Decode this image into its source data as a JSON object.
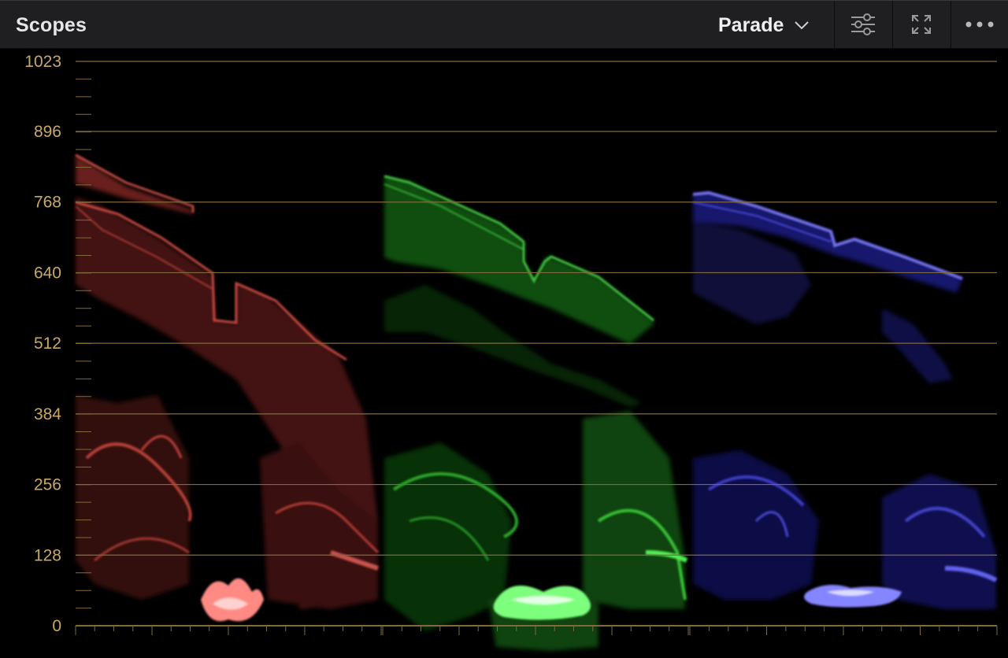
{
  "header": {
    "title": "Scopes",
    "mode_label": "Parade",
    "icons": [
      "chevron-down-icon",
      "settings-sliders-icon",
      "expand-icon",
      "more-icon"
    ]
  },
  "scope": {
    "type": "parade",
    "channels": [
      "red",
      "green",
      "blue"
    ],
    "y_range": [
      0,
      1023
    ],
    "y_ticks": [
      "1023",
      "896",
      "768",
      "640",
      "512",
      "384",
      "256",
      "128",
      "0"
    ],
    "colors": {
      "graticule": "#7f6a3e",
      "tick_label": "#c9a866",
      "red": "#ff5a50",
      "green": "#3dff3d",
      "blue": "#6464ff"
    }
  }
}
